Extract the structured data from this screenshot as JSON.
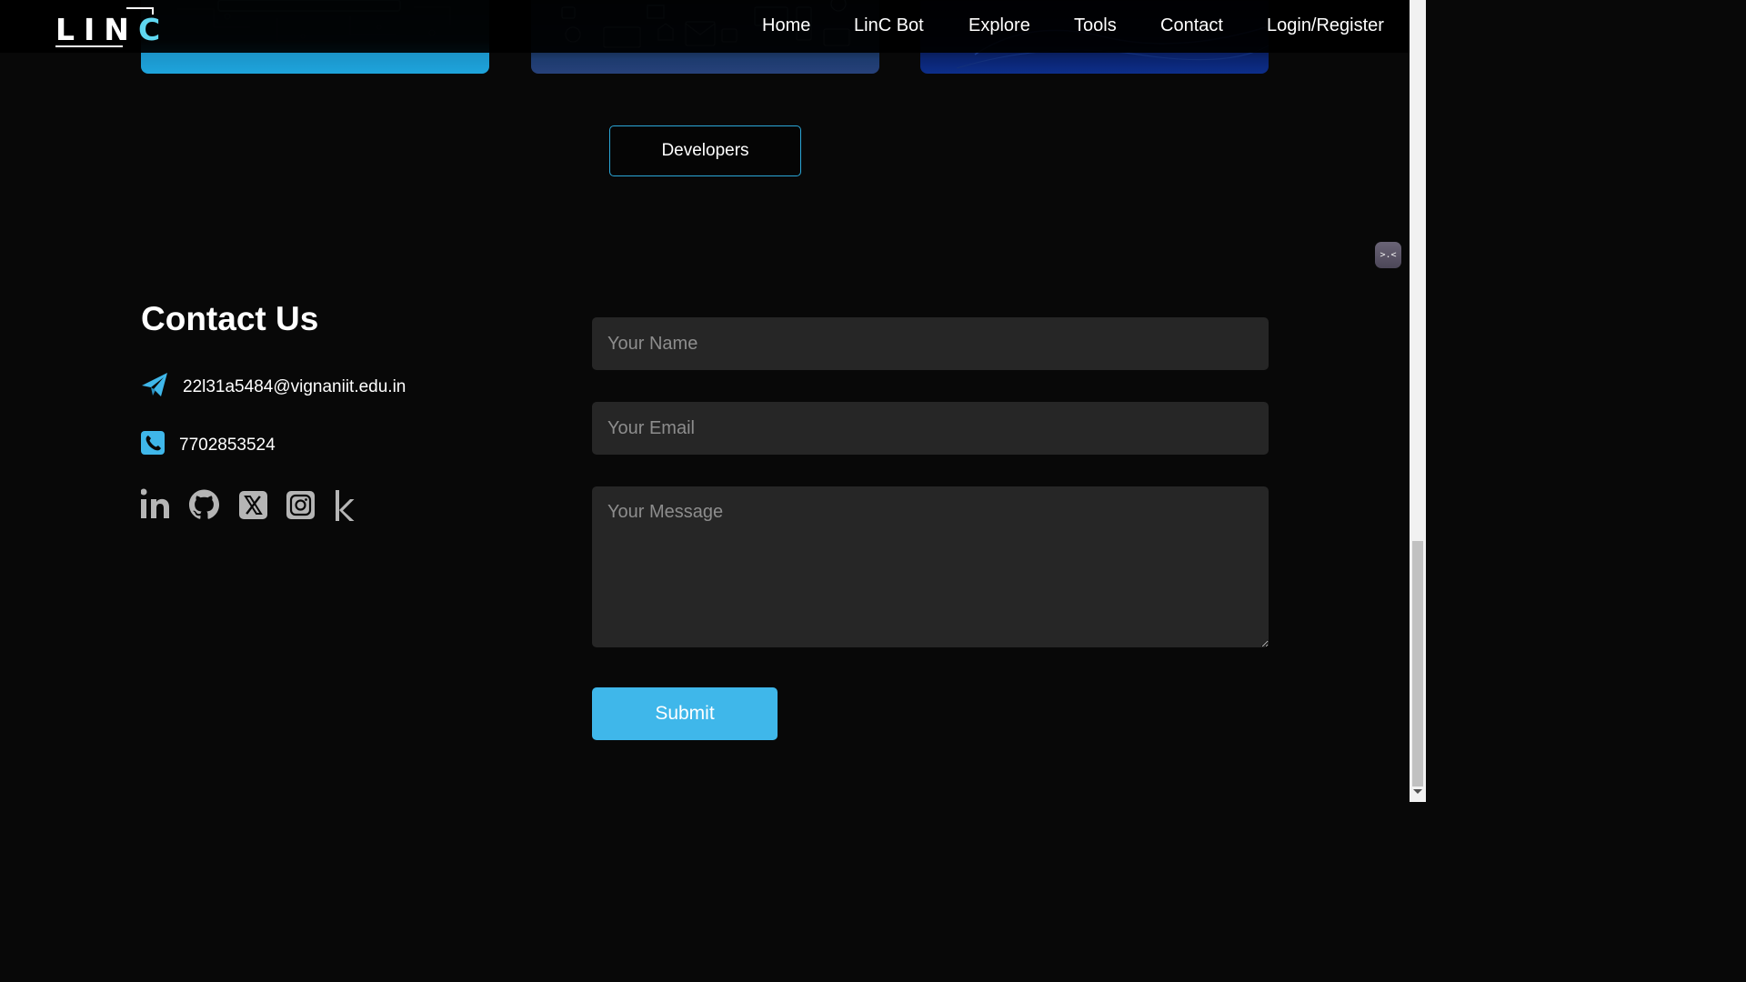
{
  "brand": {
    "logo_main": "LIN",
    "logo_accent": "C"
  },
  "nav": {
    "items": [
      {
        "label": "Home"
      },
      {
        "label": "LinC Bot"
      },
      {
        "label": "Explore"
      },
      {
        "label": "Tools"
      },
      {
        "label": "Contact"
      },
      {
        "label": "Login/Register"
      }
    ]
  },
  "developers_button": "Developers",
  "contact": {
    "title": "Contact Us",
    "email": "22l31a5484@vignaniit.edu.in",
    "phone": "7702853524",
    "socials": [
      "linkedin-icon",
      "github-icon",
      "x-twitter-icon",
      "instagram-icon",
      "kaggle-icon"
    ]
  },
  "form": {
    "name_placeholder": "Your Name",
    "email_placeholder": "Your Email",
    "message_placeholder": "Your Message",
    "submit_label": "Submit"
  },
  "chat_widget": {
    "glyph": ">.<"
  },
  "colors": {
    "accent": "#3fb7ea",
    "background": "#080808",
    "field_bg": "#262626",
    "border_accent": "#2ba7d8"
  }
}
